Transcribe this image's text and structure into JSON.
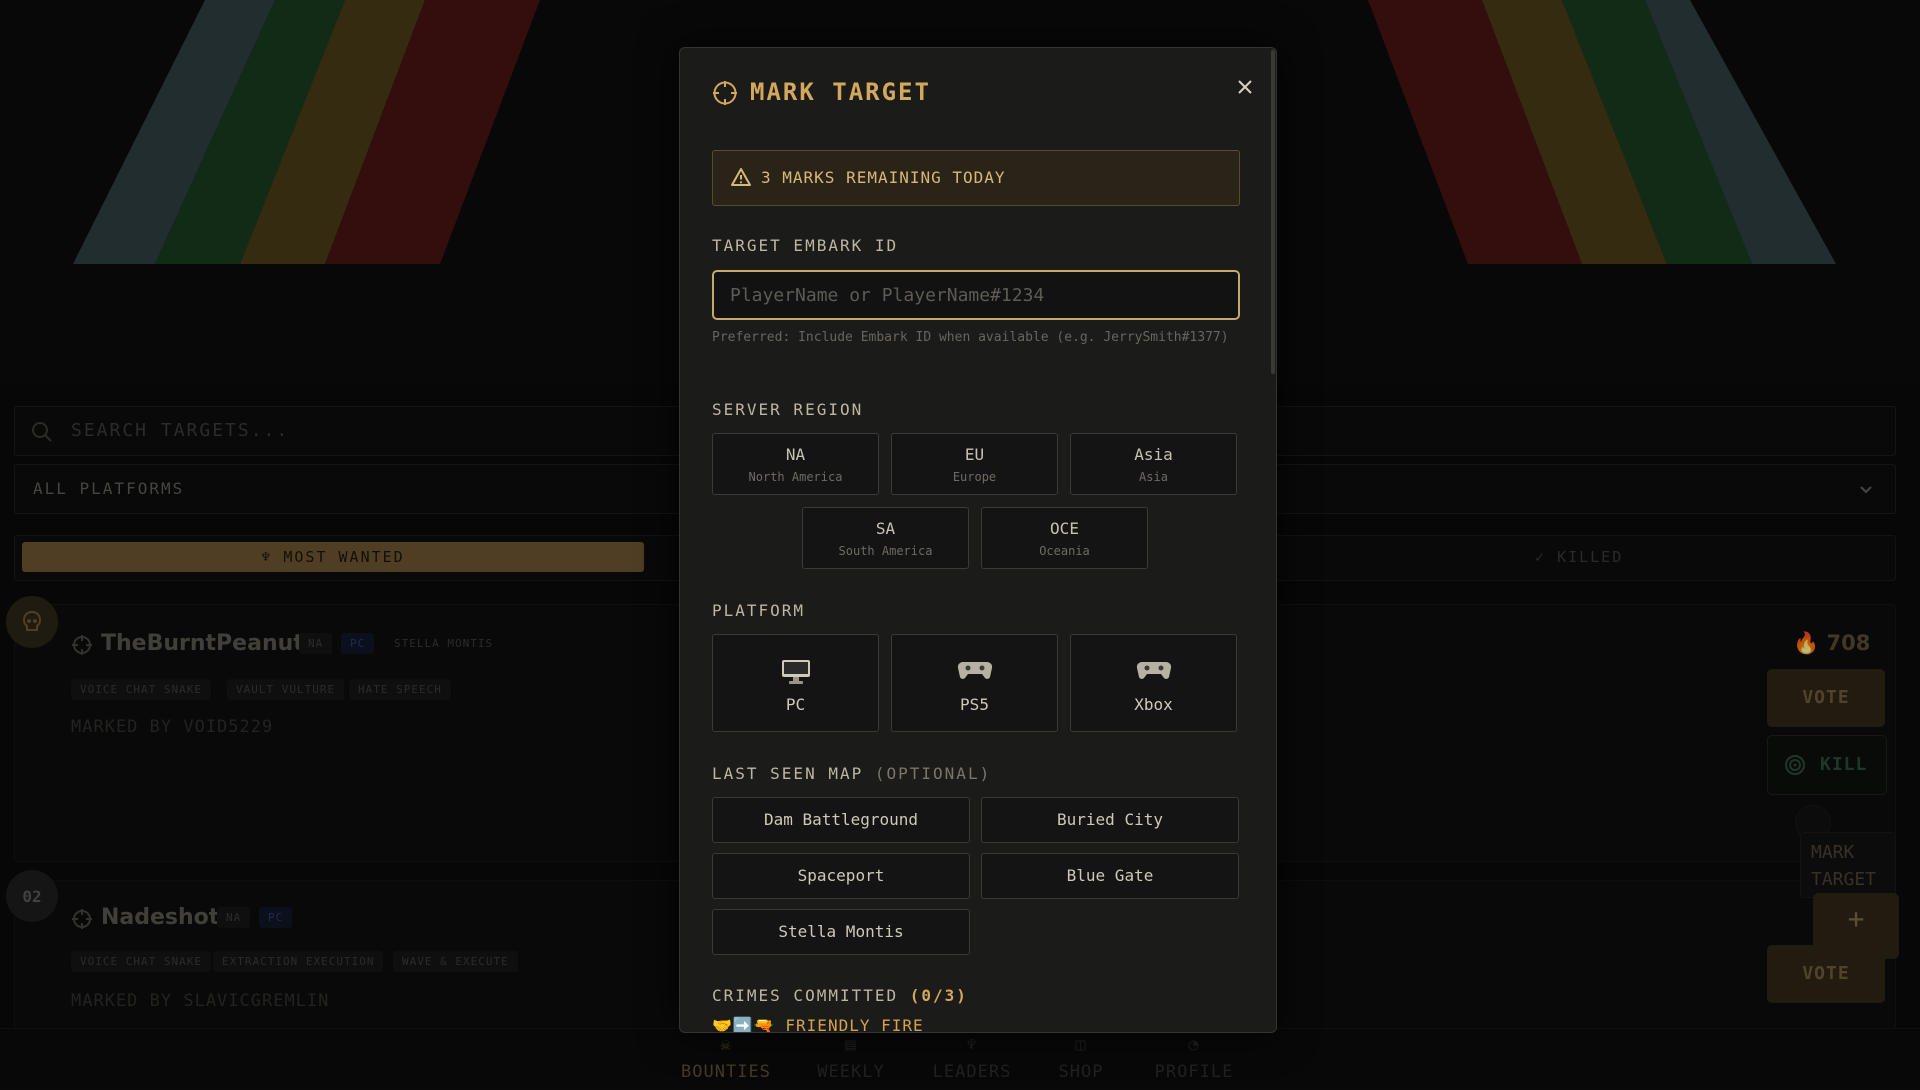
{
  "background": {
    "search": {
      "placeholder": "SEARCH TARGETS..."
    },
    "platform_filter": {
      "value": "ALL PLATFORMS"
    },
    "tabs": {
      "most_wanted": "MOST WANTED",
      "killed": "KILLED"
    },
    "targets": [
      {
        "rank": "",
        "name": "TheBurntPeanut",
        "region": "NA",
        "platform": "PC",
        "map": "STELLA MONTIS",
        "crimes": [
          "VOICE CHAT SNAKE",
          "VAULT VULTURE",
          "HATE SPEECH"
        ],
        "marked_by": "MARKED BY VOID5229",
        "score": "708",
        "vote_label": "VOTE",
        "kill_label": "KILL"
      },
      {
        "rank": "02",
        "name": "Nadeshot",
        "region": "NA",
        "platform": "PC",
        "crimes": [
          "VOICE CHAT SNAKE",
          "EXTRACTION EXECUTION",
          "WAVE & EXECUTE"
        ],
        "marked_by": "MARKED BY SLAVICGREMLIN",
        "vote_label": "VOTE"
      }
    ],
    "fab": {
      "label": "MARK TARGET",
      "plus": "+"
    },
    "bottom_nav": [
      {
        "label": "BOUNTIES",
        "icon": "skull-icon",
        "active": true
      },
      {
        "label": "WEEKLY",
        "icon": "calendar-icon",
        "active": false
      },
      {
        "label": "LEADERS",
        "icon": "trophy-icon",
        "active": false
      },
      {
        "label": "SHOP",
        "icon": "bag-icon",
        "active": false
      },
      {
        "label": "PROFILE",
        "icon": "user-icon",
        "active": false
      }
    ],
    "banner_colors": [
      "#3a4a4f",
      "#1e4a26",
      "#5a4a1a",
      "#5a1414"
    ]
  },
  "modal": {
    "title": "MARK TARGET",
    "alert": "3 MARKS REMAINING TODAY",
    "embark_label": "TARGET EMBARK ID",
    "embark_placeholder": "PlayerName or PlayerName#1234",
    "embark_value": "",
    "embark_hint": "Preferred: Include Embark ID when available (e.g. JerrySmith#1377)",
    "region_label": "SERVER REGION",
    "regions": [
      {
        "code": "NA",
        "name": "North America"
      },
      {
        "code": "EU",
        "name": "Europe"
      },
      {
        "code": "Asia",
        "name": "Asia"
      },
      {
        "code": "SA",
        "name": "South America"
      },
      {
        "code": "OCE",
        "name": "Oceania"
      }
    ],
    "platform_label": "PLATFORM",
    "platforms": [
      {
        "label": "PC",
        "icon": "monitor-icon"
      },
      {
        "label": "PS5",
        "icon": "gamepad-icon"
      },
      {
        "label": "Xbox",
        "icon": "gamepad-icon"
      }
    ],
    "map_label": "LAST SEEN MAP",
    "map_optional": "(OPTIONAL)",
    "maps": [
      "Dam Battleground",
      "Buried City",
      "Spaceport",
      "Blue Gate",
      "Stella Montis"
    ],
    "crimes_label": "CRIMES COMMITTED",
    "crimes_count": "(0/3)",
    "crime_first": "FRIENDLY FIRE",
    "accent": "#d4a85c"
  }
}
